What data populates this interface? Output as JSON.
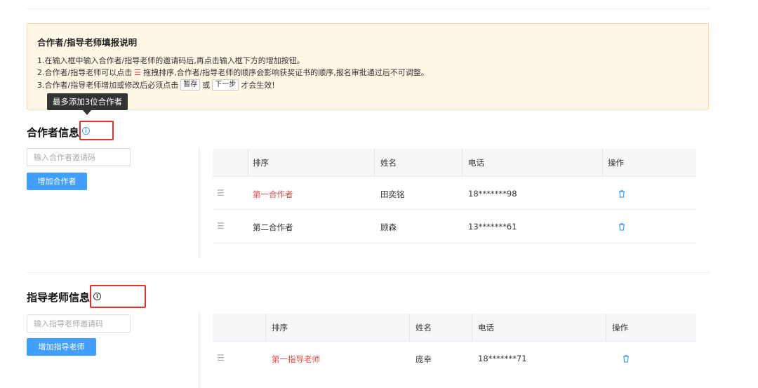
{
  "notice": {
    "title": "合作者/指导老师填报说明",
    "line1": "1.在输入框中输入合作者/指导老师的邀请码后,再点击输入框下方的增加按钮。",
    "line2_prefix": "2.合作者/指导老师可以点击",
    "line2_icon": "☰",
    "line2_suffix": "拖拽排序,合作者/指导老师的顺序会影响获奖证书的顺序,报名审批通过后不可调整。",
    "line3_prefix": "3.合作者/指导老师增加或修改后必须点击",
    "line3_btn1": "暂存",
    "line3_mid": "或",
    "line3_btn2": "下一步",
    "line3_suffix": "才会生效!"
  },
  "tooltip": "最多添加3位合作者",
  "partners": {
    "title": "合作者信息",
    "info_icon": "i",
    "input_placeholder": "输入合作者邀请码",
    "add_button": "增加合作者",
    "columns": [
      "排序",
      "姓名",
      "电话",
      "操作"
    ],
    "rows": [
      {
        "drag": "☰",
        "order": "第一合作者",
        "name": "田奕铭",
        "phone": "18*******98"
      },
      {
        "drag": "☰",
        "order": "第二合作者",
        "name": "顾森",
        "phone": "13*******61"
      }
    ]
  },
  "advisors": {
    "title": "指导老师信息",
    "info_icon": "i",
    "input_placeholder": "输入指导老师邀请码",
    "add_button": "增加指导老师",
    "columns": [
      "排序",
      "姓名",
      "电话",
      "操作"
    ],
    "rows": [
      {
        "drag": "☰",
        "order": "第一指导老师",
        "name": "庞幸",
        "phone": "18*******71"
      }
    ]
  },
  "colors": {
    "primary": "#409eff",
    "highlight_red": "#e24a4a",
    "notice_bg": "#fff8e6",
    "annotation_red": "#e2302b"
  }
}
